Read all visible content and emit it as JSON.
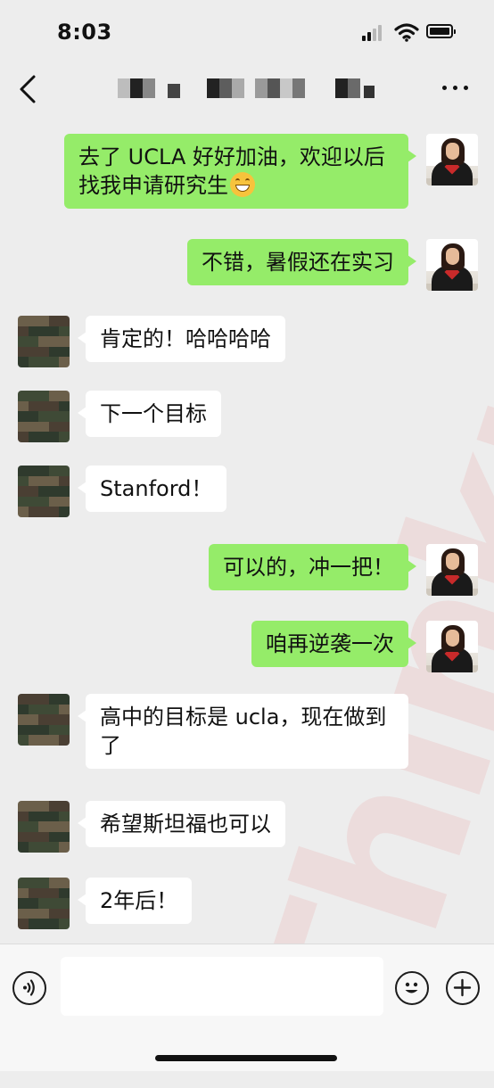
{
  "status_bar": {
    "time": "8:03"
  },
  "nav": {
    "title_redacted": true
  },
  "messages": [
    {
      "side": "out",
      "text": "去了 UCLA 好好加油，欢迎以后找我申请研究生",
      "emoji": "grinning-face-icon"
    },
    {
      "side": "out",
      "text": "不错，暑假还在实习"
    },
    {
      "side": "in",
      "text": "肯定的！哈哈哈哈"
    },
    {
      "side": "in",
      "text": "下一个目标"
    },
    {
      "side": "in",
      "text": "Stanford！"
    },
    {
      "side": "out",
      "text": "可以的，冲一把！"
    },
    {
      "side": "out",
      "text": "咱再逆袭一次"
    },
    {
      "side": "in",
      "text": "高中的目标是 ucla，现在做到了"
    },
    {
      "side": "in",
      "text": "希望斯坦福也可以"
    },
    {
      "side": "in",
      "text": "2年后！"
    }
  ],
  "watermark": "Thinkpro",
  "colors": {
    "outgoing_bubble": "#95ec69",
    "incoming_bubble": "#ffffff",
    "chat_background": "#ededed"
  }
}
